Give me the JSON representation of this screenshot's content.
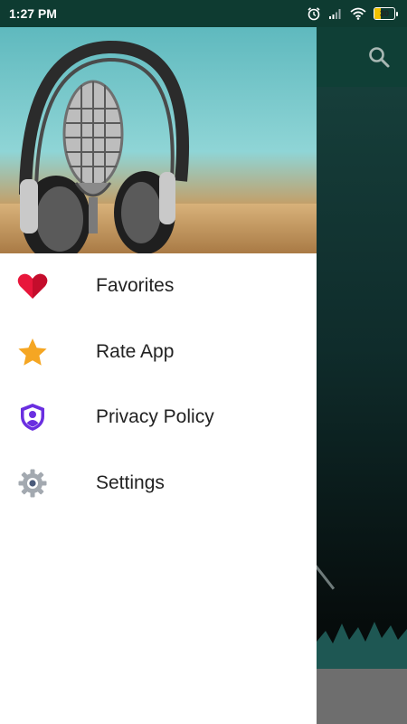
{
  "status_bar": {
    "time": "1:27 PM",
    "battery_level": "30",
    "battery_fraction": 0.3,
    "icons": [
      "alarm-icon",
      "signal-icon",
      "wifi-icon",
      "battery-icon"
    ]
  },
  "toolbar": {
    "search_icon": "search-icon"
  },
  "drawer": {
    "header_image": "microphone-with-headphones-image",
    "items": [
      {
        "label": "Favorites",
        "icon": "heart-icon",
        "color": "#e8163b"
      },
      {
        "label": "Rate App",
        "icon": "star-icon",
        "color": "#f5a623"
      },
      {
        "label": "Privacy Policy",
        "icon": "shield-user-icon",
        "color": "#6a2fe0"
      },
      {
        "label": "Settings",
        "icon": "gear-icon",
        "color": "#9aa1a8"
      }
    ]
  },
  "colors": {
    "status_bar": "#0e3b31",
    "toolbar": "#0f3f36",
    "drawer_background": "#ffffff",
    "bottom_bar": "#6e6e6e"
  }
}
